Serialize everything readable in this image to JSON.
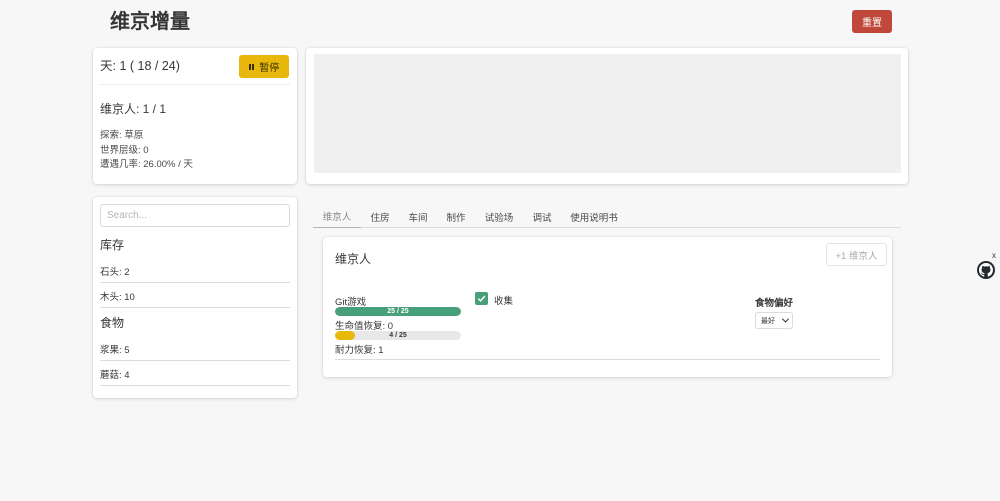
{
  "app": {
    "title": "维京增量",
    "reset_label": "重置"
  },
  "status": {
    "day_text": "天:  1 ( 18 / 24)",
    "pause_label": "暂停",
    "population_text": "维京人: 1 / 1",
    "explore_text": "探索: 草原",
    "world_level_text": "世界层级: 0",
    "encounter_text": "遭遇几率: 26.00% / 天"
  },
  "search": {
    "placeholder": "Search...",
    "value": ""
  },
  "inventory": {
    "storage_title": "库存",
    "storage_items": [
      {
        "label": "石头: 2"
      },
      {
        "label": "木头: 10"
      }
    ],
    "food_title": "食物",
    "food_items": [
      {
        "label": "浆果: 5"
      },
      {
        "label": "蘑菇: 4"
      }
    ]
  },
  "tabs": [
    {
      "label": "维京人",
      "active": true
    },
    {
      "label": "住房"
    },
    {
      "label": "车间"
    },
    {
      "label": "制作"
    },
    {
      "label": "试验场"
    },
    {
      "label": "调试"
    },
    {
      "label": "使用说明书"
    }
  ],
  "population_panel": {
    "title": "维京人",
    "add_label": "+1 维京人",
    "worker": {
      "name": "Git游戏",
      "health_bar": {
        "text": "25 / 25",
        "current": 25,
        "max": 25,
        "color": "#48a07b"
      },
      "health_regen": "生命值恢复: 0",
      "stamina_bar": {
        "text": "4 / 25",
        "current": 4,
        "max": 25,
        "color": "#e8b80c"
      },
      "stamina_regen": "耐力恢复: 1",
      "collect_label": "收集",
      "collect_checked": true
    },
    "food_pref": {
      "title": "食物偏好",
      "selected": "最好"
    }
  },
  "side_widget": {
    "close_label": "x",
    "icon": "github-icon"
  },
  "colors": {
    "reset": "#c0483b",
    "pause": "#e8b80c",
    "check": "#48a07b"
  }
}
